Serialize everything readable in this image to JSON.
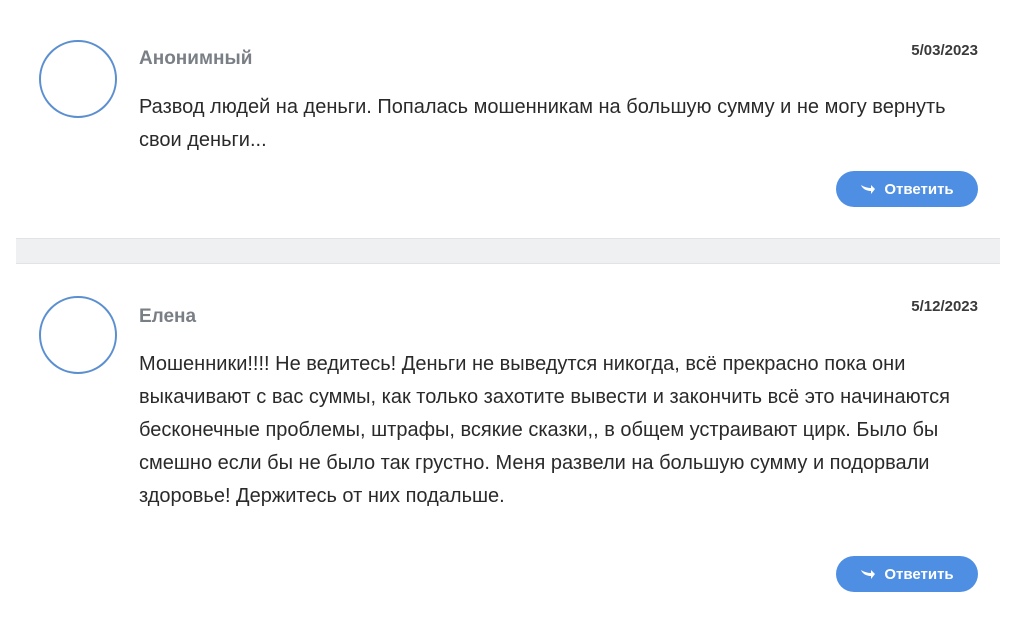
{
  "comments": [
    {
      "author": "Анонимный",
      "date": "5/03/2023",
      "text": "Развод людей на деньги. Попалась мошенникам на большую сумму и не могу вернуть свои деньги...",
      "reply_label": "Ответить"
    },
    {
      "author": "Елена",
      "date": "5/12/2023",
      "text": "Мошенники!!!! Не ведитесь! Деньги не выведутся никогда, всё прекрасно пока они выкачивают с вас суммы, как только захотите вывести и закончить всё это начинаются бесконечные проблемы, штрафы, всякие сказки,, в общем устраивают цирк. Было бы смешно если бы не было так грустно. Меня развели на большую сумму и подорвали здоровье! Держитесь от них подальше.",
      "reply_label": "Ответить"
    }
  ],
  "icons": {
    "reply": "reply-arrow-icon",
    "avatar": "avatar-placeholder"
  },
  "colors": {
    "accent": "#4f8fe3",
    "avatar_border": "#5b8fd0",
    "author": "#7a7f86",
    "separator": "#eff0f2"
  }
}
